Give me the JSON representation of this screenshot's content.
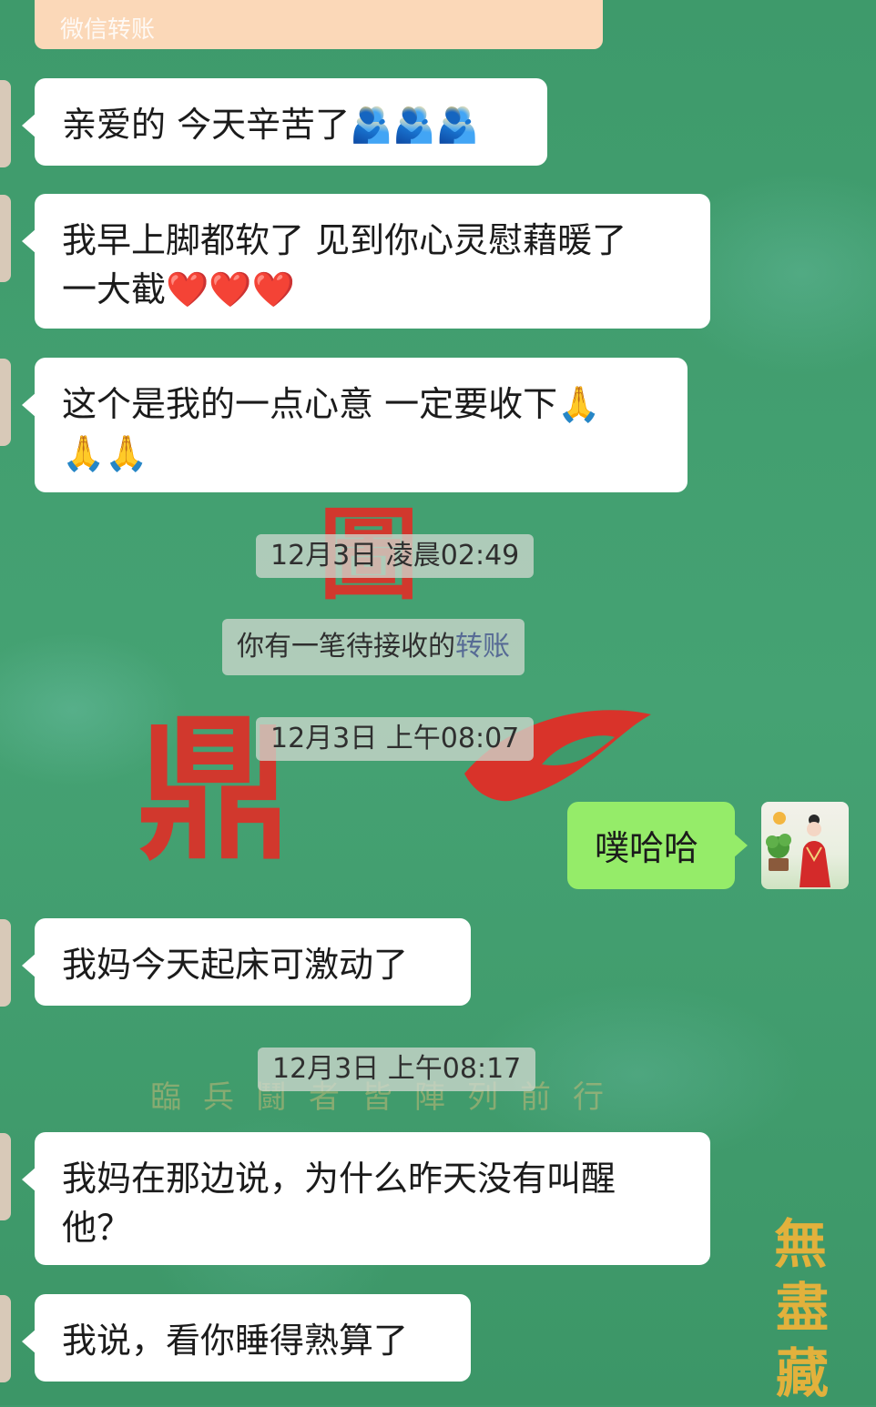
{
  "transfer_card": {
    "label": "微信转账"
  },
  "messages": [
    {
      "text": "亲爱的  今天辛苦了🫂🫂🫂"
    },
    {
      "line1": "我早上脚都软了  见到你心灵慰藉暖了",
      "line2": "一大截❤️❤️❤️"
    },
    {
      "line1": "这个是我的一点心意  一定要收下🙏",
      "line2": "🙏🙏"
    },
    {
      "text": "我妈今天起床可激动了"
    },
    {
      "line1": "我妈在那边说，为什么昨天没有叫醒",
      "line2": "他？"
    },
    {
      "text": "我说，看你睡得熟算了"
    }
  ],
  "timestamps": [
    "12月3日  凌晨02:49",
    "12月3日  上午08:07",
    "12月3日  上午08:17"
  ],
  "system_notice": {
    "prefix": "你有一笔待接收的",
    "link": "转账"
  },
  "outgoing": {
    "text": "噗哈哈"
  },
  "background_text": {
    "seal_top": "圖",
    "seal_left": "鼎",
    "faint_line": "臨兵鬪者皆陣列前行",
    "gold_1": "無",
    "gold_2": "盡",
    "gold_3": "藏"
  },
  "colors": {
    "background": "#3f9a6c",
    "incoming_bubble": "#ffffff",
    "outgoing_bubble": "#95ec69",
    "link": "#576b95"
  }
}
